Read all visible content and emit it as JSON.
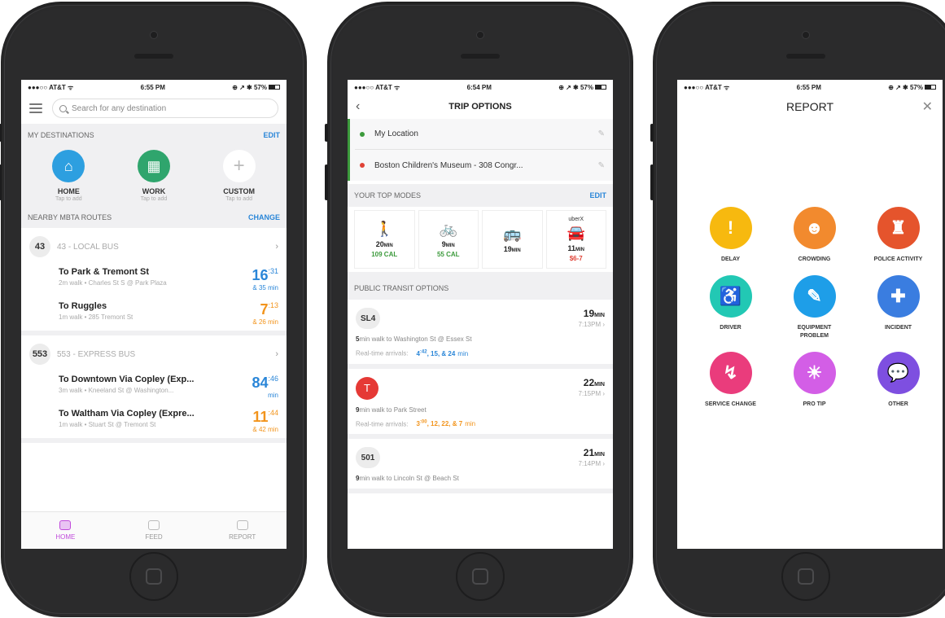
{
  "colors": {
    "accent_blue": "#2a86d8",
    "accent_orange": "#f2941c",
    "accent_purple": "#c04adb",
    "green": "#3c9a3c",
    "red": "#e04236"
  },
  "status_bars": [
    {
      "carrier": "●●●○○ AT&T ᯤ",
      "time": "6:55 PM",
      "right": "⊕ ↗ ✱ 57%"
    },
    {
      "carrier": "●●●○○ AT&T ᯤ",
      "time": "6:54 PM",
      "right": "⊕ ↗ ✱ 57%"
    },
    {
      "carrier": "●●●○○ AT&T ᯤ",
      "time": "6:55 PM",
      "right": "⊕ ↗ ✱ 57%"
    }
  ],
  "home": {
    "search_placeholder": "Search for any destination",
    "my_destinations": "MY DESTINATIONS",
    "edit": "EDIT",
    "destinations": [
      {
        "name": "HOME",
        "sub": "Tap to add",
        "icon": "house-icon",
        "glyph": "⌂",
        "color": "#2d9fe0"
      },
      {
        "name": "WORK",
        "sub": "Tap to add",
        "icon": "building-icon",
        "glyph": "▦",
        "color": "#2fa56d"
      },
      {
        "name": "CUSTOM",
        "sub": "Tap to add",
        "icon": "plus-icon",
        "glyph": "+",
        "color": "#f0f0f2"
      }
    ],
    "nearby": "NEARBY MBTA ROUTES",
    "change": "CHANGE",
    "routes": [
      {
        "num": "43",
        "name": "43 - LOCAL BUS",
        "trips": [
          {
            "to": "To Park & Tremont St",
            "sub": "2m walk • Charles St S @ Park Plaza",
            "big": "16",
            "sup": ":31",
            "mins": "& 35 min",
            "color": "blue"
          },
          {
            "to": "To Ruggles",
            "sub": "1m walk • 285 Tremont St",
            "big": "7",
            "sup": ":13",
            "mins": "& 26 min",
            "color": "orange"
          }
        ]
      },
      {
        "num": "553",
        "name": "553 - EXPRESS BUS",
        "trips": [
          {
            "to": "To Downtown Via Copley (Exp...",
            "sub": "3m walk • Kneeland St @ Washington...",
            "big": "84",
            "sup": ":46",
            "mins": "min",
            "color": "blue"
          },
          {
            "to": "To Waltham Via Copley (Expre...",
            "sub": "1m walk • Stuart St @ Tremont St",
            "big": "11",
            "sup": ":44",
            "mins": "& 42 min",
            "color": "orange"
          }
        ]
      }
    ],
    "tabs": [
      "HOME",
      "FEED",
      "REPORT"
    ]
  },
  "trip": {
    "title": "TRIP OPTIONS",
    "from": "My Location",
    "to": "Boston Children's Museum - 308 Congr...",
    "top_modes": "YOUR TOP MODES",
    "edit": "EDIT",
    "modes": [
      {
        "icon": "walk-icon",
        "glyph": "🚶",
        "label": "",
        "time": "20",
        "unit": "MIN",
        "extra": "109 CAL",
        "extra_color": "green"
      },
      {
        "icon": "bike-icon",
        "glyph": "🚲",
        "label": "",
        "time": "9",
        "unit": "MIN",
        "extra": "55 CAL",
        "extra_color": "green"
      },
      {
        "icon": "bus-icon",
        "glyph": "🚌",
        "label": "",
        "time": "19",
        "unit": "MIN",
        "extra": "",
        "extra_color": ""
      },
      {
        "icon": "car-icon",
        "glyph": "🚘",
        "label": "uberX",
        "time": "11",
        "unit": "MIN",
        "extra": "$6-7",
        "extra_color": "red"
      }
    ],
    "public_options": "PUBLIC TRANSIT OPTIONS",
    "options": [
      {
        "badge": "SL4",
        "type": "text",
        "dur": "19",
        "unit": "MIN",
        "clock": "7:13PM",
        "walk_min": "5",
        "walk": "min walk to Washington St @ Essex St",
        "arr_label": "Real-time arrivals:",
        "arr_first": "4",
        "arr_sup": ":42",
        "arr_rest": ", 15, & 24",
        "arr_unit": "min",
        "arr_color": "blue"
      },
      {
        "badge": "T",
        "type": "train",
        "dur": "22",
        "unit": "MIN",
        "clock": "7:15PM",
        "walk_min": "9",
        "walk": "min walk to Park Street",
        "arr_label": "Real-time arrivals:",
        "arr_first": "3",
        "arr_sup": ":00",
        "arr_rest": ", 12, 22, & 7",
        "arr_unit": "min",
        "arr_color": "orange"
      },
      {
        "badge": "501",
        "type": "text",
        "dur": "21",
        "unit": "MIN",
        "clock": "7:14PM",
        "walk_min": "9",
        "walk": "min walk to Lincoln St @ Beach St",
        "arr_label": "",
        "arr_first": "",
        "arr_sup": "",
        "arr_rest": "",
        "arr_unit": "",
        "arr_color": ""
      }
    ]
  },
  "report": {
    "title": "REPORT",
    "items": [
      {
        "label": "DELAY",
        "icon": "exclamation-icon",
        "glyph": "!",
        "color": "#f7b90f"
      },
      {
        "label": "CROWDING",
        "icon": "crowd-icon",
        "glyph": "☻",
        "color": "#f28a2e"
      },
      {
        "label": "POLICE ACTIVITY",
        "icon": "police-icon",
        "glyph": "♜",
        "color": "#e5542c"
      },
      {
        "label": "DRIVER",
        "icon": "driver-icon",
        "glyph": "♿",
        "color": "#22c8b4"
      },
      {
        "label": "EQUIPMENT PROBLEM",
        "icon": "wrench-icon",
        "glyph": "✎",
        "color": "#1e9ee8"
      },
      {
        "label": "INCIDENT",
        "icon": "bandage-icon",
        "glyph": "✚",
        "color": "#3a7de0"
      },
      {
        "label": "SERVICE CHANGE",
        "icon": "route-change-icon",
        "glyph": "↯",
        "color": "#ea3c7c"
      },
      {
        "label": "PRO TIP",
        "icon": "lightbulb-icon",
        "glyph": "☀",
        "color": "#d35ee6"
      },
      {
        "label": "OTHER",
        "icon": "chat-bubble-icon",
        "glyph": "💬",
        "color": "#7e4fe0"
      }
    ]
  }
}
